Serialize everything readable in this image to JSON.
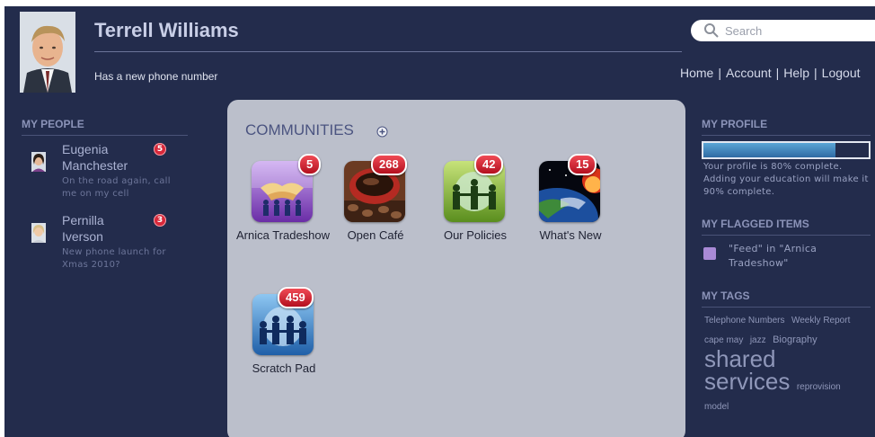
{
  "user": {
    "name": "Terrell Williams",
    "status": "Has a new phone number"
  },
  "search": {
    "placeholder": "Search"
  },
  "topnav": {
    "items": [
      "Home",
      "Account",
      "Help",
      "Logout"
    ]
  },
  "people": {
    "title": "MY PEOPLE",
    "items": [
      {
        "name": "Eugenia Manchester",
        "message": "On the road again, call me on my cell",
        "badge": "5"
      },
      {
        "name": "Pernilla Iverson",
        "message": "New phone launch for Xmas 2010?",
        "badge": "3"
      }
    ]
  },
  "communities": {
    "title": "COMMUNITIES",
    "items": [
      {
        "label": "Arnica Tradeshow",
        "badge": "5",
        "icon": "handshake-icon"
      },
      {
        "label": "Open Café",
        "badge": "268",
        "icon": "coffee-icon"
      },
      {
        "label": "Our Policies",
        "badge": "42",
        "icon": "people-globe-icon"
      },
      {
        "label": "What's New",
        "badge": "15",
        "icon": "earth-icon"
      },
      {
        "label": "Scratch Pad",
        "badge": "459",
        "icon": "people-circle-icon"
      }
    ]
  },
  "profile": {
    "title": "MY PROFILE",
    "progress": 0.8,
    "text": "Your profile is 80% complete. Adding your education will make it 90% complete."
  },
  "flagged": {
    "title": "MY FLAGGED ITEMS",
    "items": [
      {
        "text": "\"Feed\" in \"Arnica Tradeshow\""
      }
    ]
  },
  "tags": {
    "title": "MY TAGS",
    "items": [
      {
        "text": "Telephone Numbers",
        "size": 10
      },
      {
        "text": "Weekly Report",
        "size": 10
      },
      {
        "text": "cape may",
        "size": 10
      },
      {
        "text": "jazz",
        "size": 10
      },
      {
        "text": "Biography",
        "size": 11
      },
      {
        "text": "shared",
        "size": 26
      },
      {
        "text": "services",
        "size": 26
      },
      {
        "text": "reprovision",
        "size": 10
      },
      {
        "text": "model",
        "size": 10
      }
    ]
  },
  "colors": {
    "background": "#232c4c",
    "panel": "#bbbfcb",
    "badge": "#d8283a",
    "progress_fill": "#3f86c0"
  }
}
